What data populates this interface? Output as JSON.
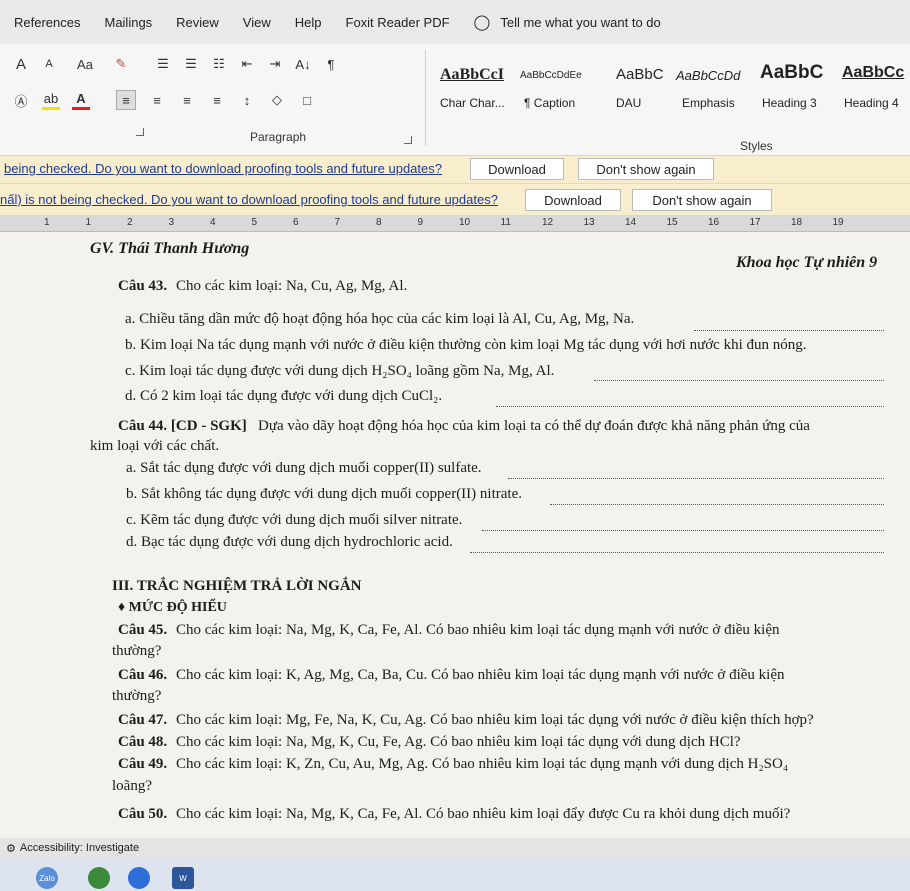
{
  "ribbon_tabs": [
    "References",
    "Mailings",
    "Review",
    "View",
    "Help",
    "Foxit Reader PDF"
  ],
  "tell_me": "Tell me what you want to do",
  "font_group": {
    "grow": "A",
    "shrink": "A",
    "case": "Aa",
    "sort": "A↓",
    "pilcrow": "¶"
  },
  "groups": {
    "paragraph": "Paragraph",
    "styles": "Styles"
  },
  "styles": [
    {
      "preview": "AaBbCcI",
      "name": "Char Char..."
    },
    {
      "preview": "AaBbCcDdEe",
      "name": "¶ Caption"
    },
    {
      "preview": "AaBbC",
      "name": "DAU"
    },
    {
      "preview": "AaBbCcDd",
      "name": "Emphasis"
    },
    {
      "preview": "AaBbC",
      "name": "Heading 3"
    },
    {
      "preview": "AaBbCc",
      "name": "Heading 4"
    }
  ],
  "notification_1": {
    "message": "being checked. Do you want to download proofing tools and future updates?",
    "download": "Download",
    "dismiss": "Don't show again"
  },
  "notification_2": {
    "message": "nấl) is not being checked. Do you want to download proofing tools and future updates?",
    "download": "Download",
    "dismiss": "Don't show again"
  },
  "ruler_numbers": [
    "1",
    "1",
    "2",
    "3",
    "4",
    "5",
    "6",
    "7",
    "8",
    "9",
    "10",
    "11",
    "12",
    "13",
    "14",
    "15",
    "16",
    "17",
    "18",
    "19"
  ],
  "document": {
    "author": "GV. Thái Thanh Hương",
    "subject": "Khoa học Tự nhiên 9",
    "q43": {
      "label": "Câu 43.",
      "text": " Cho các kim loại: Na, Cu, Ag, Mg, Al.",
      "a": "a. Chiều tăng dần mức độ hoạt động hóa học của các kim loại là Al, Cu, Ag, Mg, Na.",
      "b": "b. Kim loại Na tác dụng mạnh với nước ở điều kiện thường còn kim loại Mg tác dụng với hơi nước khi đun nóng.",
      "c": "c. Kim loại tác dụng được với dung dịch H₂SO₄ loãng gồm Na, Mg, Al.",
      "d": "d. Có 2 kim loại tác dụng được với dung dịch CuCl₂."
    },
    "q44": {
      "label": "Câu 44. [CD - SGK]",
      "text": " Dựa vào dãy hoạt động hóa học của kim loại ta có thể dự đoán được khả năng phản ứng của",
      "text2": "kim loại với các chất.",
      "a": "a. Sắt tác dụng được với dung dịch muối copper(II) sulfate.",
      "b": "b. Sắt không tác dụng được với dung dịch muối copper(II) nitrate.",
      "c": "c. Kẽm tác dụng được với dung dịch muối silver nitrate.",
      "d": "d. Bạc tác dụng được với dung dịch hydrochloric acid."
    },
    "section": "III. TRẮC NGHIỆM TRẢ LỜI NGẮN",
    "level": "♦ MỨC ĐỘ HIỂU",
    "q45": {
      "label": "Câu 45.",
      "text": " Cho các kim loại: Na, Mg, K, Ca, Fe, Al. Có bao nhiêu kim loại tác dụng mạnh với nước ở điều kiện",
      "text2": "thường?"
    },
    "q46": {
      "label": "Câu 46.",
      "text": " Cho các kim loại: K, Ag, Mg, Ca, Ba, Cu. Có bao nhiêu kim loại tác dụng mạnh với nước ở điều kiện",
      "text2": "thường?"
    },
    "q47": {
      "label": "Câu 47.",
      "text": " Cho các kim loại: Mg, Fe, Na, K, Cu, Ag. Có bao nhiêu kim loại tác dụng với nước ở điều kiện thích hợp?"
    },
    "q48": {
      "label": "Câu 48.",
      "text": " Cho các kim loại: Na, Mg, K, Cu, Fe, Ag. Có bao nhiêu kim loại tác dụng với dung dịch HCl?"
    },
    "q49": {
      "label": "Câu 49.",
      "text": " Cho các kim loại: K, Zn, Cu, Au, Mg, Ag. Có bao nhiêu kim loại tác dụng mạnh với dung dịch H₂SO₄",
      "text2": "loãng?"
    },
    "q50": {
      "label": "Câu 50.",
      "text": " Cho các kim loại: Na, Mg, K, Ca, Fe, Al. Có bao nhiêu kim loại đẩy được Cu ra khỏi dung dịch muối?"
    }
  },
  "status_bar": {
    "accessibility": "Accessibility: Investigate"
  },
  "taskbar": {
    "zalo": "Zalo",
    "word": "W"
  }
}
